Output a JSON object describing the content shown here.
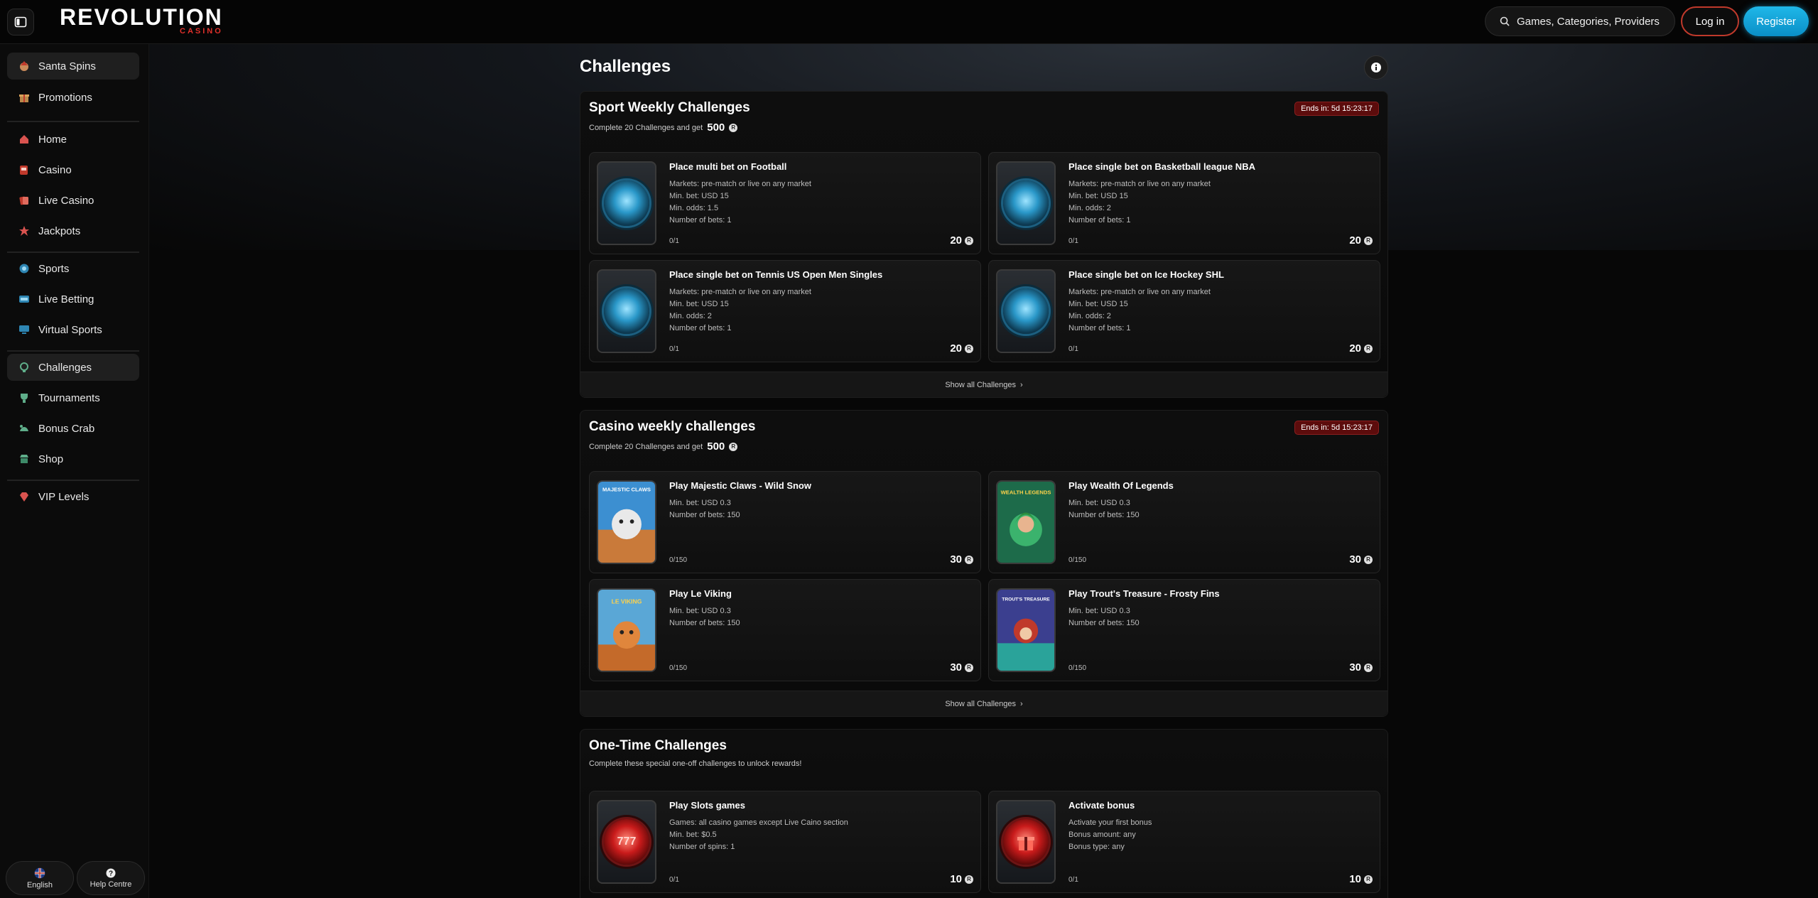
{
  "header": {
    "logo_main": "REVOLUTION",
    "logo_sub": "CASINO",
    "search_placeholder": "Games, Categories, Providers",
    "login_label": "Log in",
    "register_label": "Register"
  },
  "sidebar": {
    "items": [
      {
        "label": "Santa Spins",
        "icon": "santa-icon"
      },
      {
        "label": "Promotions",
        "icon": "gift-icon"
      },
      {
        "label": "Home",
        "icon": "home-icon"
      },
      {
        "label": "Casino",
        "icon": "slot-machine-icon"
      },
      {
        "label": "Live Casino",
        "icon": "cards-icon"
      },
      {
        "label": "Jackpots",
        "icon": "jackpot-icon"
      },
      {
        "label": "Sports",
        "icon": "sports-icon"
      },
      {
        "label": "Live Betting",
        "icon": "live-icon"
      },
      {
        "label": "Virtual Sports",
        "icon": "monitor-icon"
      },
      {
        "label": "Challenges",
        "icon": "trophy-icon"
      },
      {
        "label": "Tournaments",
        "icon": "cup-icon"
      },
      {
        "label": "Bonus Crab",
        "icon": "crab-icon"
      },
      {
        "label": "Shop",
        "icon": "shop-icon"
      },
      {
        "label": "VIP Levels",
        "icon": "diamond-icon"
      }
    ],
    "language_label": "English",
    "help_label": "Help Centre"
  },
  "main": {
    "title": "Challenges",
    "sections": [
      {
        "title": "Sport Weekly Challenges",
        "subtitle": "Complete 20 Challenges and get",
        "subtitle_amount": "500",
        "ends": "Ends in: 5d 15:23:17",
        "show_all": "Show all Challenges",
        "cards": [
          {
            "title": "Place multi bet on Football",
            "lines": [
              "Markets: pre-match or live on any market",
              "Min. bet: USD 15",
              "Min. odds: 1.5",
              "Number of bets: 1"
            ],
            "progress": "0/1",
            "reward": "20"
          },
          {
            "title": "Place single bet on Basketball league NBA",
            "lines": [
              "Markets: pre-match or live on any market",
              "Min. bet: USD 15",
              "Min. odds: 2",
              "Number of bets: 1"
            ],
            "progress": "0/1",
            "reward": "20"
          },
          {
            "title": "Place single bet on Tennis US Open Men Singles",
            "lines": [
              "Markets: pre-match or live on any market",
              "Min. bet: USD 15",
              "Min. odds: 2",
              "Number of bets: 1"
            ],
            "progress": "0/1",
            "reward": "20"
          },
          {
            "title": "Place single bet on Ice Hockey SHL",
            "lines": [
              "Markets: pre-match or live on any market",
              "Min. bet: USD 15",
              "Min. odds: 2",
              "Number of bets: 1"
            ],
            "progress": "0/1",
            "reward": "20"
          }
        ]
      },
      {
        "title": "Casino weekly challenges",
        "subtitle": "Complete 20 Challenges and get",
        "subtitle_amount": "500",
        "ends": "Ends in: 5d 15:23:17",
        "show_all": "Show all Challenges",
        "cards": [
          {
            "title": "Play Majestic Claws - Wild Snow",
            "lines": [
              "Min. bet: USD 0.3",
              "Number of bets: 150"
            ],
            "progress": "0/150",
            "reward": "30"
          },
          {
            "title": "Play Wealth Of Legends",
            "lines": [
              "Min. bet: USD 0.3",
              "Number of bets: 150"
            ],
            "progress": "0/150",
            "reward": "30"
          },
          {
            "title": "Play Le Viking",
            "lines": [
              "Min. bet: USD 0.3",
              "Number of bets: 150"
            ],
            "progress": "0/150",
            "reward": "30"
          },
          {
            "title": "Play Trout's Treasure - Frosty Fins",
            "lines": [
              "Min. bet: USD 0.3",
              "Number of bets: 150"
            ],
            "progress": "0/150",
            "reward": "30"
          }
        ]
      },
      {
        "title": "One-Time Challenges",
        "subtitle": "Complete these special one-off challenges to unlock rewards!",
        "cards": [
          {
            "title": "Play Slots games",
            "lines": [
              "Games: all casino games except Live Caino section",
              "Min. bet: $0.5",
              "Number of spins: 1"
            ],
            "progress": "0/1",
            "reward": "10"
          },
          {
            "title": "Activate bonus",
            "lines": [
              "Activate your first bonus",
              "Bonus amount: any",
              "Bonus type: any"
            ],
            "progress": "0/1",
            "reward": "10"
          }
        ]
      }
    ]
  },
  "art_text": {
    "majestic": "MAJESTIC CLAWS",
    "wealth": "WEALTH LEGENDS",
    "viking": "LE VIKING",
    "trout": "TROUT'S TREASURE",
    "slots": "777"
  },
  "colors": {
    "accent_register": "#1fb7e8",
    "accent_login_border": "#c0392b",
    "ends_badge": "#5c0c0c",
    "logo_sub": "#e0302a"
  }
}
